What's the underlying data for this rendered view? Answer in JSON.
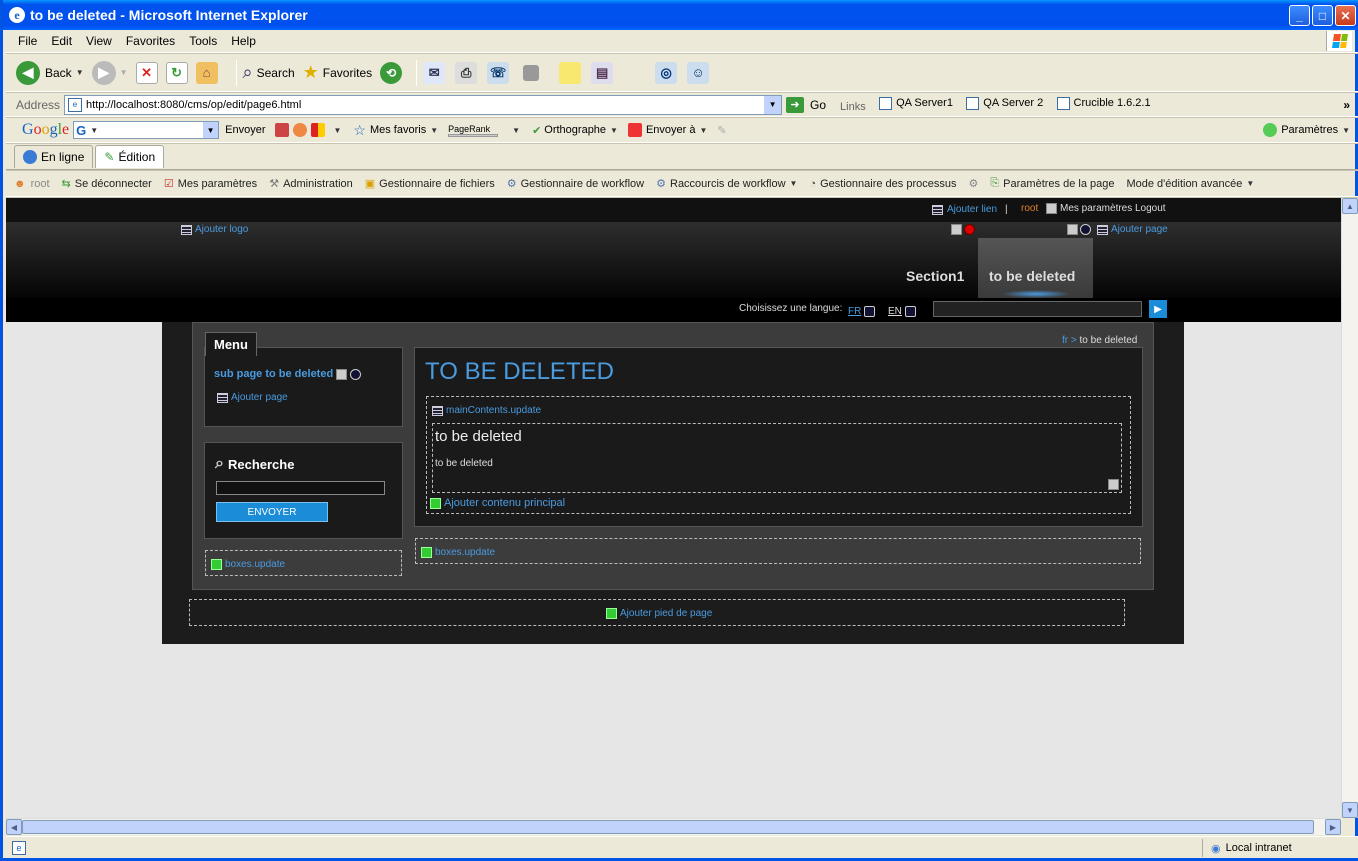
{
  "window": {
    "title": "to be deleted - Microsoft Internet Explorer"
  },
  "menubar": {
    "items": [
      "File",
      "Edit",
      "View",
      "Favorites",
      "Tools",
      "Help"
    ]
  },
  "toolbar": {
    "back_label": "Back",
    "search_label": "Search",
    "favorites_label": "Favorites"
  },
  "address": {
    "label": "Address",
    "url": "http://localhost:8080/cms/op/edit/page6.html",
    "go_label": "Go",
    "links_label": "Links",
    "links": [
      "QA Server1",
      "QA Server 2",
      "Crucible 1.6.2.1"
    ]
  },
  "google": {
    "logo": "Google",
    "envoyer": "Envoyer",
    "favoris": "Mes favoris",
    "pagerank": "PageRank",
    "ortho": "Orthographe",
    "envoyer_a": "Envoyer à",
    "params": "Paramètres"
  },
  "tabs": {
    "online": "En ligne",
    "edit": "Édition"
  },
  "wcm": {
    "user": "root",
    "logout": "Se déconnecter",
    "myparams": "Mes paramètres",
    "admin": "Administration",
    "files": "Gestionnaire de fichiers",
    "workflow": "Gestionnaire de workflow",
    "shortcuts": "Raccourcis de workflow",
    "process": "Gestionnaire des processus",
    "page_params": "Paramètres de la page",
    "mode": "Mode d'édition avancée"
  },
  "site": {
    "add_link": "Ajouter lien",
    "sep": "|",
    "user": "root",
    "my_params": "Mes paramètres",
    "logout": "Logout",
    "add_logo": "Ajouter logo",
    "add_page": "Ajouter page",
    "nav": [
      "Section1",
      "to be deleted"
    ],
    "lang_label": "Choisissez une langue:",
    "lang_fr": "FR",
    "lang_en": "EN",
    "menu_title": "Menu",
    "subpage": "sub page to be deleted",
    "menu_add_page": "Ajouter page",
    "search_title": "Recherche",
    "search_btn": "ENVOYER",
    "boxes_left": "boxes.update",
    "boxes_right": "boxes.update",
    "breadcrumb_home": "fr",
    "breadcrumb_sep": ">",
    "breadcrumb_current": "to be deleted",
    "page_title": "TO BE DELETED",
    "main_contents": "mainContents.update",
    "content_title": "to be deleted",
    "content_body": "to be deleted",
    "add_main": "Ajouter contenu principal",
    "add_footer": "Ajouter pied de page"
  },
  "status": {
    "zone": "Local intranet"
  }
}
